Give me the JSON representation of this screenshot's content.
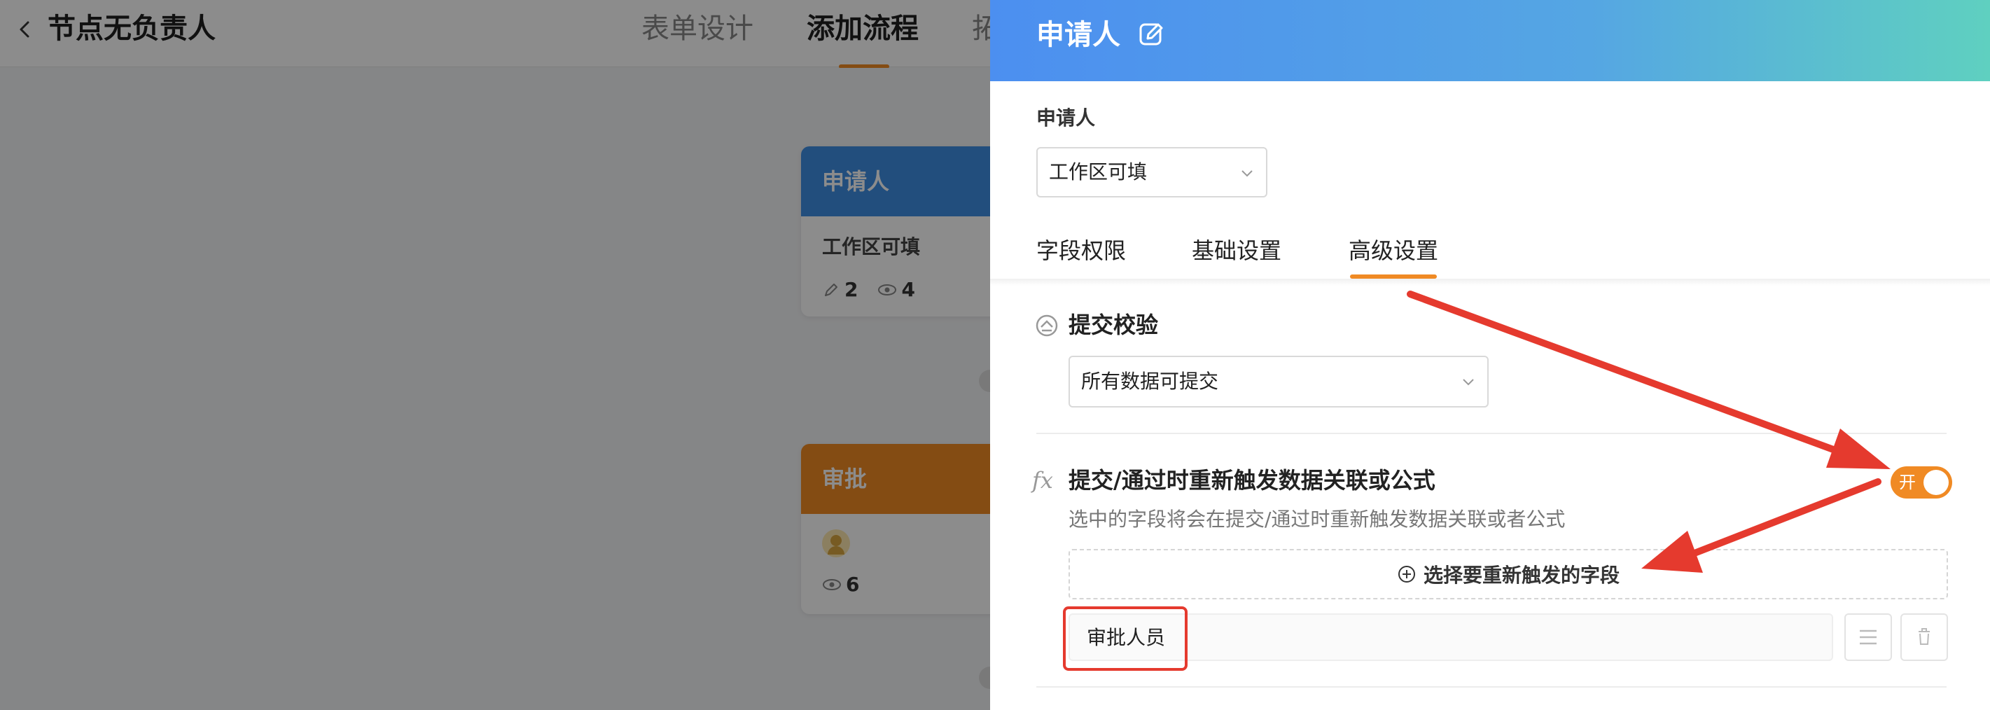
{
  "app": {
    "title": "节点无负责人"
  },
  "top_tabs": [
    {
      "label": "表单设计"
    },
    {
      "label": "添加流程"
    },
    {
      "label": "拓"
    }
  ],
  "flow": {
    "applicant_node": {
      "title": "申请人",
      "subtitle": "工作区可填",
      "edit_count": "2",
      "view_count": "4"
    },
    "approve_node": {
      "title": "审批",
      "view_count": "6"
    }
  },
  "drawer": {
    "title": "申请人",
    "applicant_label": "申请人",
    "applicant_select": "工作区可填",
    "tabs": [
      {
        "label": "字段权限"
      },
      {
        "label": "基础设置"
      },
      {
        "label": "高级设置"
      }
    ],
    "submit_validation": {
      "title": "提交校验",
      "select_value": "所有数据可提交"
    },
    "retrigger": {
      "title": "提交/通过时重新触发数据关联或公式",
      "hint": "选中的字段将会在提交/通过时重新触发数据关联或者公式",
      "toggle_label": "开",
      "toggle_on": true,
      "add_label": "选择要重新触发的字段",
      "fields": [
        {
          "name": "审批人员"
        }
      ]
    }
  },
  "colors": {
    "accent": "#f08a24",
    "header_gradient_start": "#4c8ff0",
    "header_gradient_end": "#5fd0c0",
    "annotation_red": "#e53a2e"
  }
}
